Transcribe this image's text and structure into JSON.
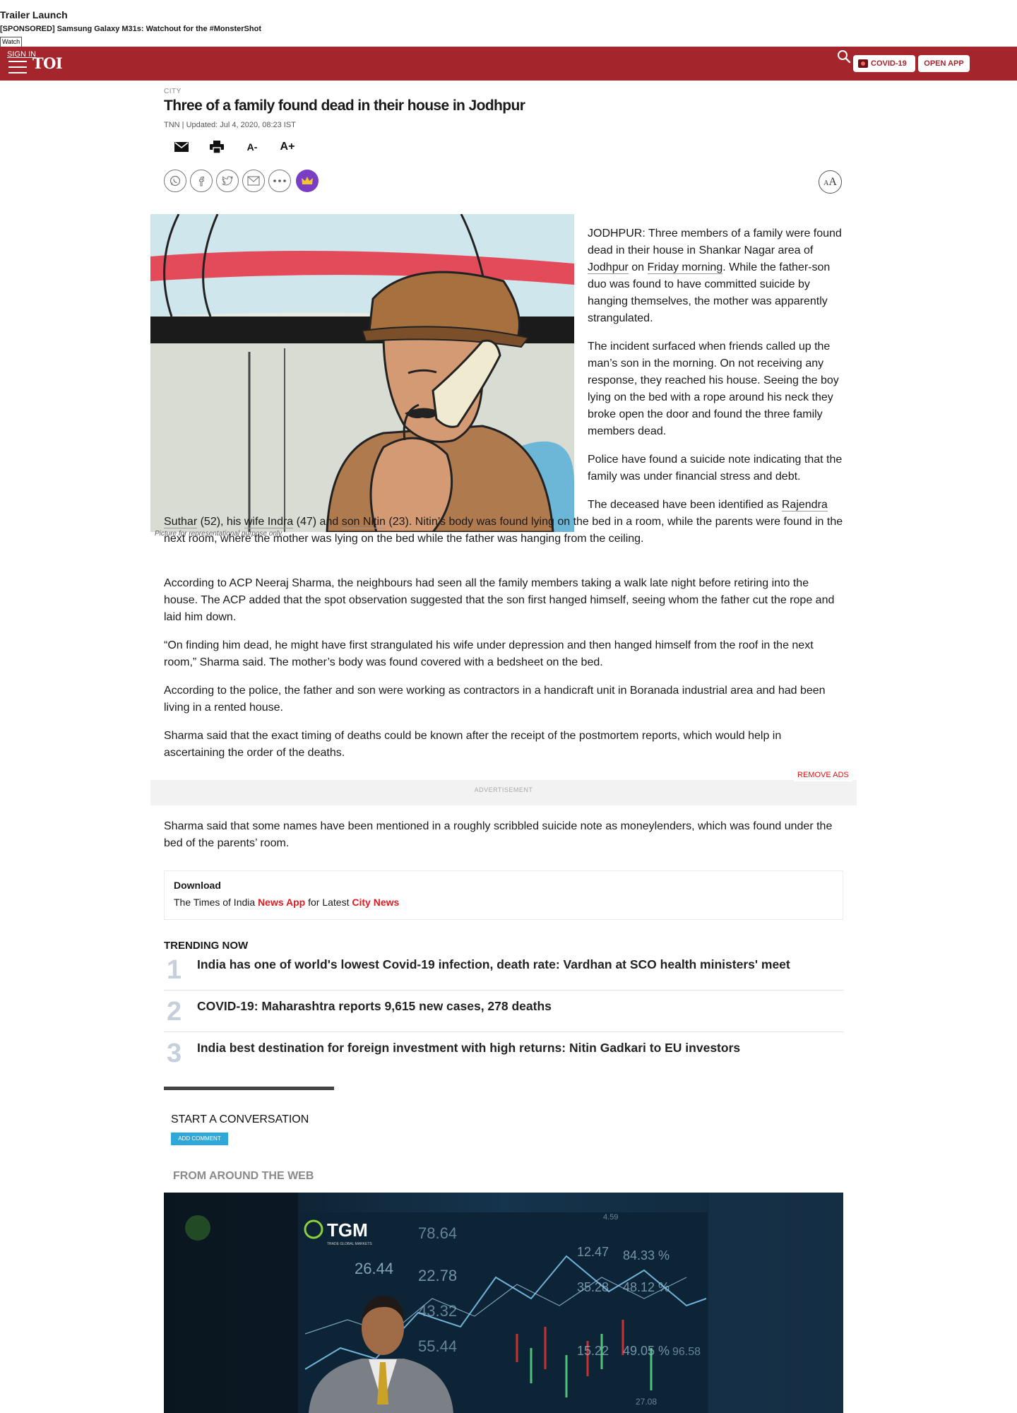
{
  "promo": {
    "title": "Trailer Launch",
    "sponsored": "[SPONSORED] Samsung Galaxy M31s: Watchout for the #MonsterShot",
    "watch_label": "Watch"
  },
  "navbar": {
    "signin": "SIGN IN",
    "logo": "TOI",
    "covid_label": "COVID-19",
    "openapp_label": "OPEN APP",
    "color": "#a4262c"
  },
  "article": {
    "section": "CITY",
    "headline": "Three of a family found dead in their house in Jodhpur",
    "byline": "TNN | Updated: Jul 4, 2020, 08:23 IST",
    "tools": {
      "font_minus": "A-",
      "font_plus": "A+"
    },
    "aa": {
      "small": "A",
      "large": "A"
    },
    "image_caption": "Picture for representational purpose only.",
    "p1": {
      "a": "JODHPUR: Three members of a family were found dead in their house in Shankar Nagar area of ",
      "link1": "Jodhpur",
      "b": " on ",
      "link2": "Friday morning",
      "c": ". While the father-son duo was found to have committed suicide by hanging themselves, the mother was apparently strangulated."
    },
    "p2": "The incident surfaced when friends called up the man’s son in the morning. On not receiving any response, they reached his house. Seeing the boy lying on the bed with a rope around his neck they broke open the door and found the three family members dead.",
    "p3": "Police have found a suicide note indicating that the family was under financial stress and debt.",
    "p4": {
      "a": "The deceased have been identified as ",
      "link1": "Rajendra Suthar",
      "b": " (52), his ",
      "link2": "wife Indra",
      "c": " (47) and ",
      "link3": "son Nitin",
      "d": " (23). Nitin’s body was found lying on the bed in a room, while the parents were found in the next room, where the mother was lying on the bed while the father was hanging from the ceiling."
    },
    "p5": "According to ACP Neeraj Sharma, the neighbours had seen all the family members taking a walk late night before retiring into the house. The ACP added that the spot observation suggested that the son first hanged himself, seeing whom the father cut the rope and laid him down.",
    "p6": "“On finding him dead, he might have first strangulated his wife under depression and then hanged himself from the roof in the next room,” Sharma said. The mother’s body was found covered with a bedsheet on the bed.",
    "p7": "According to the police, the father and son were working as contractors in a handicraft unit in Boranada industrial area and had been living in a rented house.",
    "p8": "Sharma said that the exact timing of deaths could be known after the receipt of the postmortem reports, which would help in ascertaining the order of the deaths.",
    "p9": "Sharma said that some names have been mentioned in a roughly scribbled suicide note as moneylenders, which was found under the bed of the parents’ room."
  },
  "ads": {
    "remove_ads": "REMOVE ADS",
    "advertisement": "ADVERTISEMENT"
  },
  "download": {
    "title": "Download",
    "pre": "The Times of India ",
    "app": "News App",
    "mid": " for Latest ",
    "city": "City News"
  },
  "trending": {
    "heading": "TRENDING NOW",
    "items": [
      {
        "num": "1",
        "text": "India has one of world's lowest Covid-19 infection, death rate: Vardhan at SCO health ministers' meet"
      },
      {
        "num": "2",
        "text": "COVID-19: Maharashtra reports 9,615 new cases, 278 deaths"
      },
      {
        "num": "3",
        "text": "India best destination for foreign investment with high returns: Nitin Gadkari to EU investors"
      }
    ]
  },
  "conversation": {
    "heading": "START A CONVERSATION",
    "add_comment": "ADD COMMENT"
  },
  "around_web": {
    "heading": "FROM AROUND THE WEB",
    "ad_brand": "TGM",
    "ad_brand_sub": "TRADE GLOBAL MARKETS",
    "ad_numbers": [
      "26.44",
      "22.78",
      "12.47",
      "84.33 %",
      "35.28",
      "48.12 %",
      "15.22",
      "49.05 %",
      "78.64",
      "43.32",
      "55.44",
      "96.58",
      "27.08",
      "4.59"
    ]
  }
}
